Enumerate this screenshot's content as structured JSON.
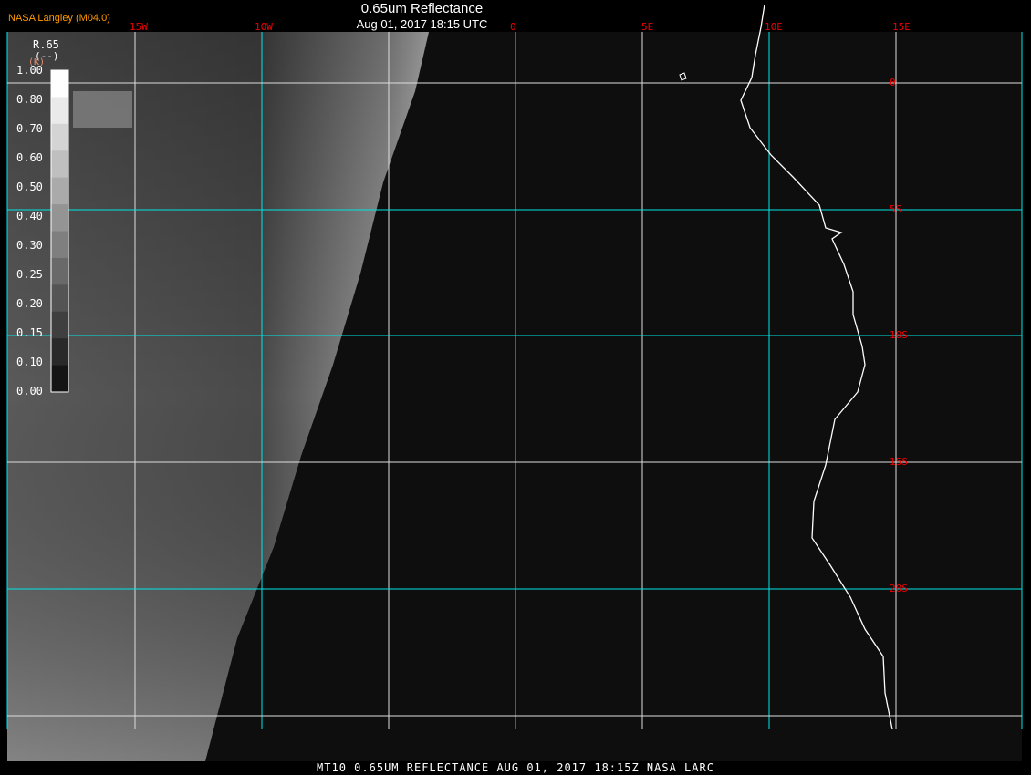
{
  "title": "0.65um Reflectance",
  "subtitle": "Aug 01, 2017 18:15 UTC",
  "credit": "NASA Langley (M04.0)",
  "footer": "MT10  0.65UM REFLECTANCE   AUG 01, 2017 18:15Z   NASA LARC",
  "lon_labels": [
    "15W",
    "10W",
    "0",
    "5E",
    "10E",
    "15E"
  ],
  "lat_labels": [
    "0",
    "5S",
    "10S",
    "15S",
    "20S"
  ],
  "colorbar": {
    "name": "R.65",
    "units": "(--)",
    "units_alt": "(K)",
    "ticks": [
      "1.00",
      "0.80",
      "0.70",
      "0.60",
      "0.50",
      "0.40",
      "0.30",
      "0.25",
      "0.20",
      "0.15",
      "0.10",
      "0.00"
    ]
  },
  "colors": {
    "grid_major": "#00e5e5",
    "grid_minor": "#dddddd",
    "labels": "#ee0000",
    "credit": "#ff9900"
  }
}
